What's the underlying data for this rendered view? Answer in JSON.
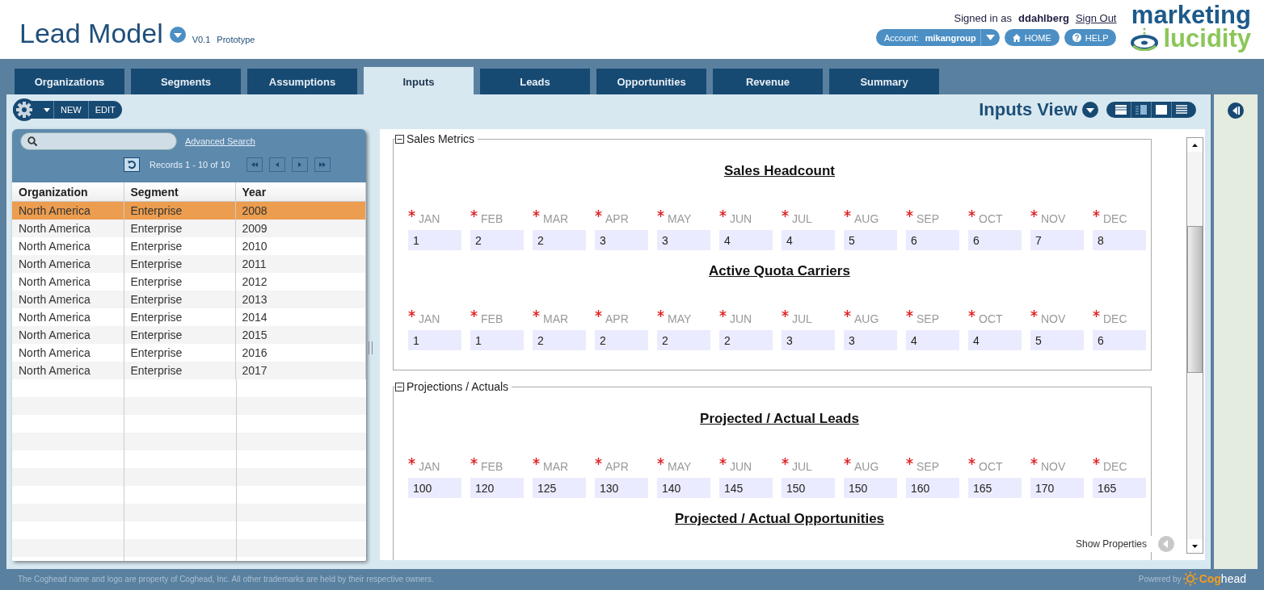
{
  "app": {
    "title": "Lead Model",
    "version": "V0.1",
    "stage": "Prototype"
  },
  "user": {
    "signed_in_label": "Signed in as",
    "username": "ddahlberg",
    "sign_out": "Sign Out",
    "account_label": "Account:",
    "account": "mikangroup",
    "home": "HOME",
    "help": "HELP"
  },
  "logo": {
    "line_1": "marketing",
    "line_2": "lucidity"
  },
  "tabs": [
    {
      "label": "Organizations",
      "selected": false
    },
    {
      "label": "Segments",
      "selected": false
    },
    {
      "label": "Assumptions",
      "selected": false
    },
    {
      "label": "Inputs",
      "selected": true
    },
    {
      "label": "Leads",
      "selected": false
    },
    {
      "label": "Opportunities",
      "selected": false
    },
    {
      "label": "Revenue",
      "selected": false
    },
    {
      "label": "Summary",
      "selected": false
    }
  ],
  "toolbar": {
    "new": "NEW",
    "edit": "EDIT"
  },
  "view": {
    "title": "Inputs View"
  },
  "list": {
    "advanced_search": "Advanced Search",
    "records": "Records 1 - 10 of 10",
    "columns": [
      "Organization",
      "Segment",
      "Year"
    ],
    "rows": [
      {
        "cells": [
          "North America",
          "Enterprise",
          "2008"
        ],
        "selected": true
      },
      {
        "cells": [
          "North America",
          "Enterprise",
          "2009"
        ],
        "selected": false
      },
      {
        "cells": [
          "North America",
          "Enterprise",
          "2010"
        ],
        "selected": false
      },
      {
        "cells": [
          "North America",
          "Enterprise",
          "2011"
        ],
        "selected": false
      },
      {
        "cells": [
          "North America",
          "Enterprise",
          "2012"
        ],
        "selected": false
      },
      {
        "cells": [
          "North America",
          "Enterprise",
          "2013"
        ],
        "selected": false
      },
      {
        "cells": [
          "North America",
          "Enterprise",
          "2014"
        ],
        "selected": false
      },
      {
        "cells": [
          "North America",
          "Enterprise",
          "2015"
        ],
        "selected": false
      },
      {
        "cells": [
          "North America",
          "Enterprise",
          "2016"
        ],
        "selected": false
      },
      {
        "cells": [
          "North America",
          "Enterprise",
          "2017"
        ],
        "selected": false
      }
    ]
  },
  "sections": [
    {
      "title": "Sales Metrics",
      "expanded": true,
      "groups": [
        {
          "title": "Sales Headcount",
          "fields": [
            {
              "label": "JAN",
              "required": true,
              "value": "1"
            },
            {
              "label": "FEB",
              "required": true,
              "value": "2"
            },
            {
              "label": "MAR",
              "required": true,
              "value": "2"
            },
            {
              "label": "APR",
              "required": true,
              "value": "3"
            },
            {
              "label": "MAY",
              "required": true,
              "value": "3"
            },
            {
              "label": "JUN",
              "required": true,
              "value": "4"
            },
            {
              "label": "JUL",
              "required": true,
              "value": "4"
            },
            {
              "label": "AUG",
              "required": true,
              "value": "5"
            },
            {
              "label": "SEP",
              "required": true,
              "value": "6"
            },
            {
              "label": "OCT",
              "required": true,
              "value": "6"
            },
            {
              "label": "NOV",
              "required": true,
              "value": "7"
            },
            {
              "label": "DEC",
              "required": true,
              "value": "8"
            }
          ]
        },
        {
          "title": "Active Quota Carriers",
          "fields": [
            {
              "label": "JAN",
              "required": true,
              "value": "1"
            },
            {
              "label": "FEB",
              "required": true,
              "value": "1"
            },
            {
              "label": "MAR",
              "required": true,
              "value": "2"
            },
            {
              "label": "APR",
              "required": true,
              "value": "2"
            },
            {
              "label": "MAY",
              "required": true,
              "value": "2"
            },
            {
              "label": "JUN",
              "required": true,
              "value": "2"
            },
            {
              "label": "JUL",
              "required": true,
              "value": "3"
            },
            {
              "label": "AUG",
              "required": true,
              "value": "3"
            },
            {
              "label": "SEP",
              "required": true,
              "value": "4"
            },
            {
              "label": "OCT",
              "required": true,
              "value": "4"
            },
            {
              "label": "NOV",
              "required": true,
              "value": "5"
            },
            {
              "label": "DEC",
              "required": true,
              "value": "6"
            }
          ]
        }
      ]
    },
    {
      "title": "Projections / Actuals",
      "expanded": true,
      "groups": [
        {
          "title": "Projected / Actual Leads",
          "fields": [
            {
              "label": "JAN",
              "required": true,
              "value": "100"
            },
            {
              "label": "FEB",
              "required": true,
              "value": "120"
            },
            {
              "label": "MAR",
              "required": true,
              "value": "125"
            },
            {
              "label": "APR",
              "required": true,
              "value": "130"
            },
            {
              "label": "MAY",
              "required": true,
              "value": "140"
            },
            {
              "label": "JUN",
              "required": true,
              "value": "145"
            },
            {
              "label": "JUL",
              "required": true,
              "value": "150"
            },
            {
              "label": "AUG",
              "required": true,
              "value": "150"
            },
            {
              "label": "SEP",
              "required": true,
              "value": "160"
            },
            {
              "label": "OCT",
              "required": true,
              "value": "165"
            },
            {
              "label": "NOV",
              "required": true,
              "value": "170"
            },
            {
              "label": "DEC",
              "required": true,
              "value": "165"
            }
          ]
        },
        {
          "title": "Projected / Actual Opportunities"
        }
      ]
    }
  ],
  "show_properties": "Show Properties",
  "footer": {
    "notice": "The Coghead name and logo are property of Coghead, Inc. All other trademarks are held by their respective owners.",
    "powered_by": "Powered by",
    "brand_accent": "Cog",
    "brand_rest": "head"
  }
}
